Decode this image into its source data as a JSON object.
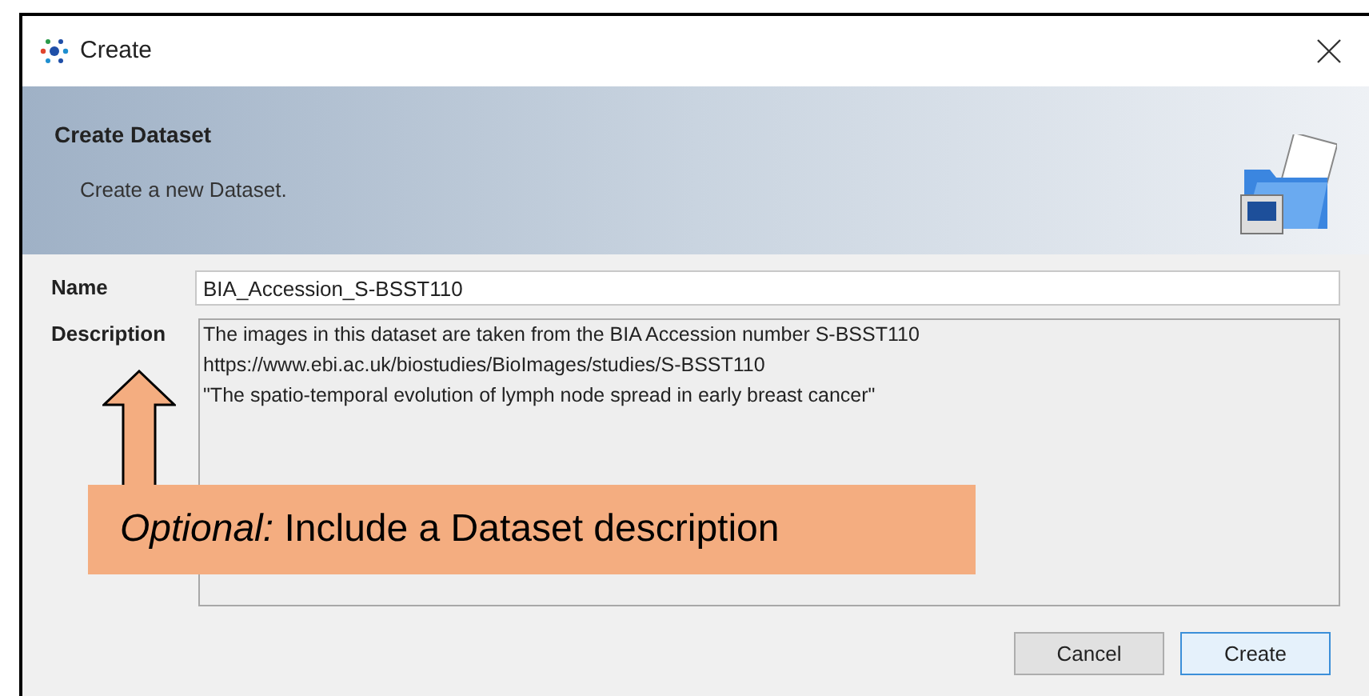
{
  "window": {
    "title": "Create"
  },
  "header": {
    "title": "Create Dataset",
    "subtitle": "Create a new Dataset."
  },
  "form": {
    "name": {
      "label": "Name",
      "value": "BIA_Accession_S-BSST110"
    },
    "description": {
      "label": "Description",
      "lines": [
        "The images in this dataset are taken from the BIA Accession number S-BSST110",
        "https://www.ebi.ac.uk/biostudies/BioImages/studies/S-BSST110",
        "\"The spatio-temporal evolution of lymph node spread in early breast cancer\""
      ]
    }
  },
  "buttons": [
    {
      "label": "Cancel",
      "kind": "secondary"
    },
    {
      "label": "Create",
      "kind": "primary"
    }
  ],
  "callout": {
    "text": "*Optional:* Include a Dataset description"
  }
}
